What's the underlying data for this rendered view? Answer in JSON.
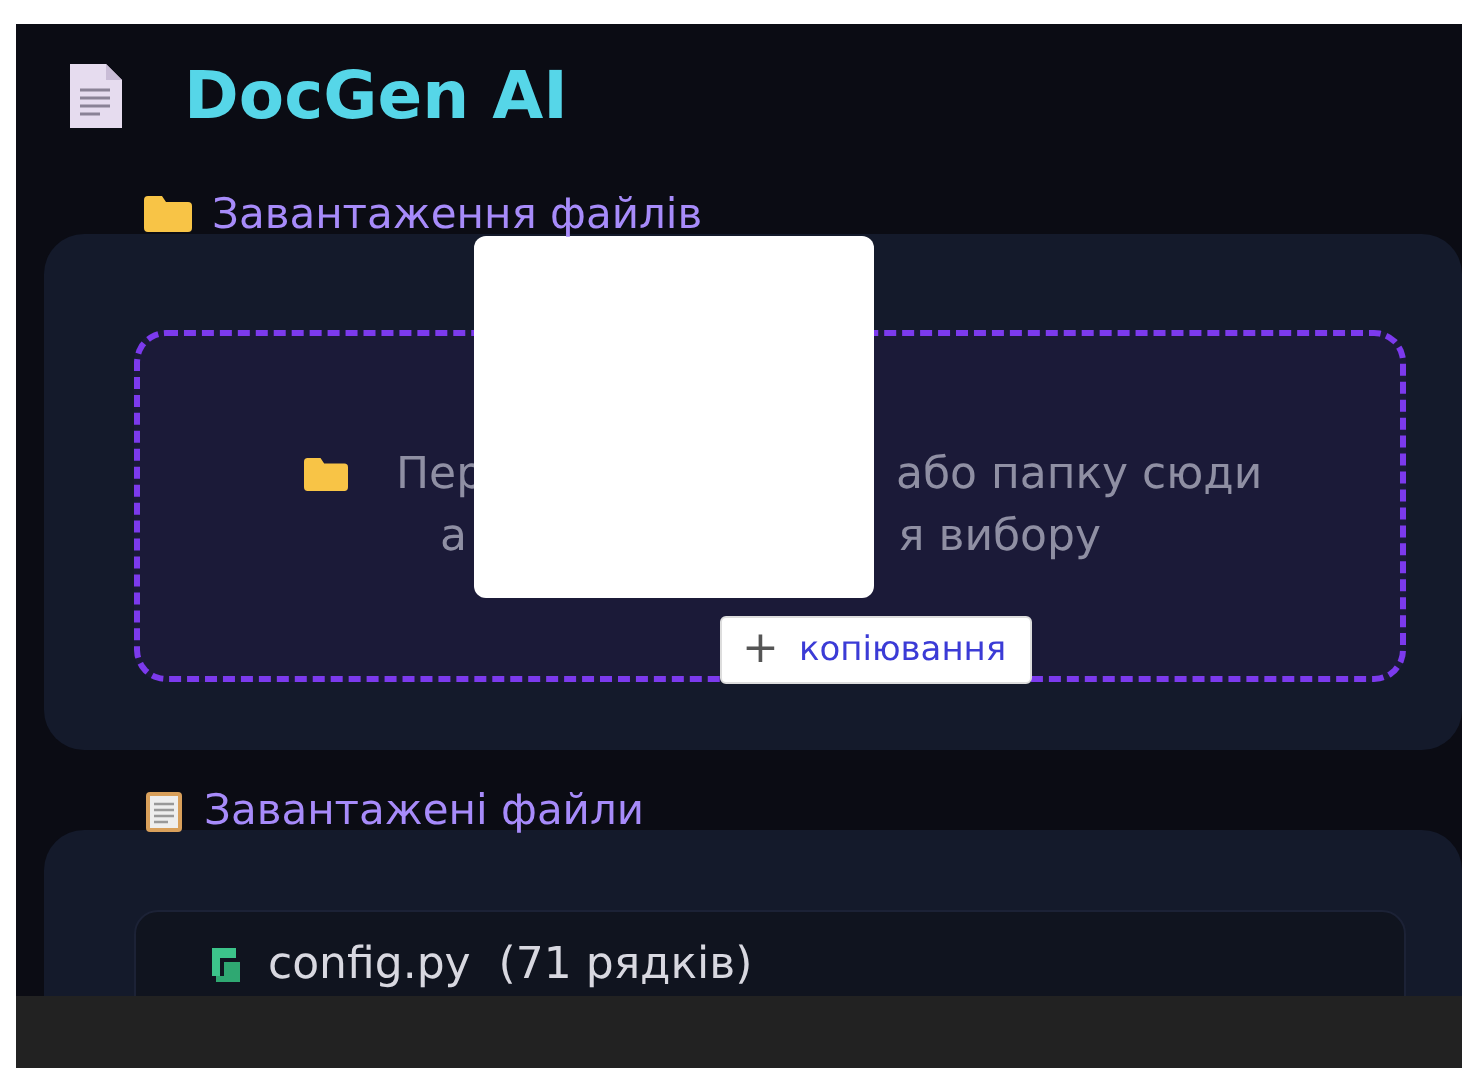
{
  "app": {
    "title": "DocGen AI"
  },
  "upload": {
    "label": "Завантаження файлів",
    "drop_lines": [
      [
        "Пер",
        "або папку сюди"
      ],
      [
        "а",
        "я вибору"
      ]
    ]
  },
  "drag_preview": {
    "badge": {
      "symbol": "+",
      "label": "копіювання"
    }
  },
  "files": {
    "label": "Завантажені файли",
    "items": [
      {
        "name": "config.py",
        "lines": "(71 рядків)"
      }
    ]
  }
}
